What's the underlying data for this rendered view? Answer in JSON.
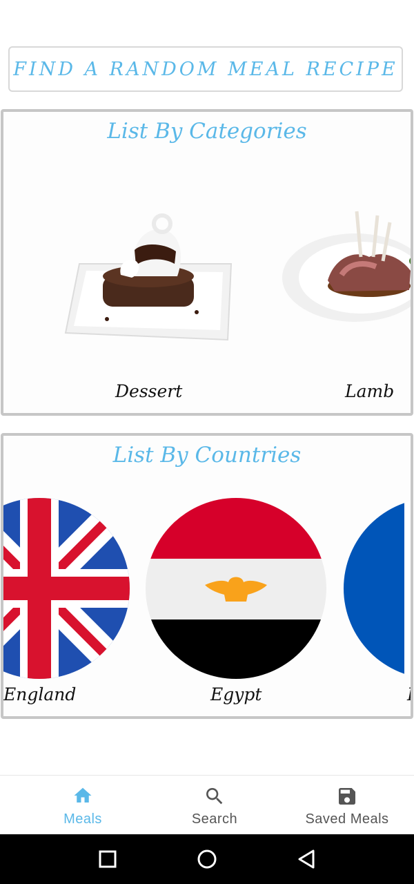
{
  "random_button": {
    "label": "FIND A RANDOM MEAL RECIPE"
  },
  "categories": {
    "title": "List By Categories",
    "items": [
      {
        "label": "Dessert",
        "icon": "dessert-image"
      },
      {
        "label": "Lamb",
        "icon": "lamb-image"
      }
    ]
  },
  "countries": {
    "title": "List By Countries",
    "items": [
      {
        "label": "England",
        "icon": "uk-flag-image"
      },
      {
        "label": "Egypt",
        "icon": "egypt-flag-image"
      },
      {
        "label": "F",
        "icon": "france-flag-image"
      }
    ]
  },
  "bottom_nav": {
    "items": [
      {
        "label": "Meals",
        "icon": "home-icon",
        "active": true
      },
      {
        "label": "Search",
        "icon": "search-icon",
        "active": false
      },
      {
        "label": "Saved Meals",
        "icon": "save-icon",
        "active": false
      }
    ]
  },
  "colors": {
    "accent": "#5ab8e8",
    "card_border": "#c6c6c6",
    "text": "#111111"
  }
}
